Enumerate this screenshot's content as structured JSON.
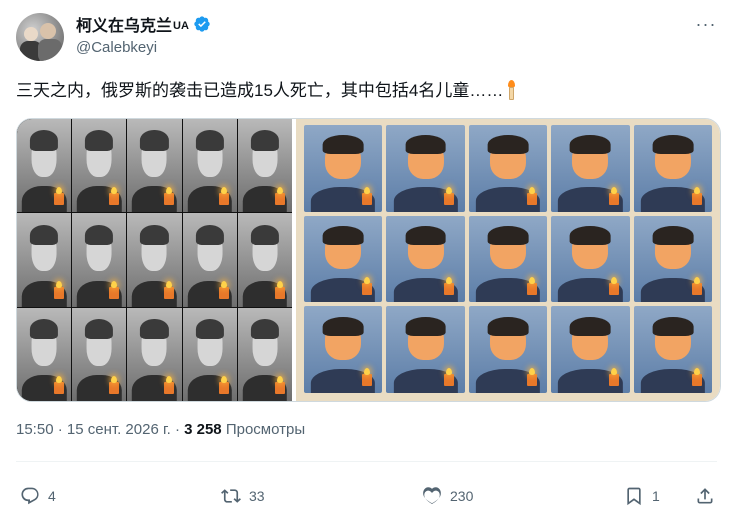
{
  "author": {
    "display_name": "柯义在乌克兰",
    "name_suffix": "UA",
    "handle": "@Calebkeyi",
    "verified": true
  },
  "tweet": {
    "text": "三天之内，俄罗斯的袭击已造成15人死亡，其中包括4名儿童……",
    "emoji": "candle"
  },
  "media": {
    "left_panel": {
      "style": "black-and-white memorial photo grid",
      "rows": 3,
      "cols": 5
    },
    "right_panel": {
      "style": "illustrated memorial portrait grid",
      "rows": 3,
      "cols": 5
    }
  },
  "meta": {
    "time": "15:50",
    "separator": "·",
    "date": "15 сент. 2026 г.",
    "views_count": "3 258",
    "views_label": "Просмотры"
  },
  "actions": {
    "replies": "4",
    "reposts": "33",
    "likes": "230",
    "bookmarks": "1"
  },
  "icons": [
    "verified-badge-icon",
    "more-icon",
    "candle-icon",
    "reply-icon",
    "repost-icon",
    "like-icon",
    "bookmark-icon",
    "share-icon"
  ],
  "colors": {
    "accent": "#1d9bf0",
    "text": "#0f1419",
    "muted": "#536471",
    "divider": "#eff3f4"
  }
}
